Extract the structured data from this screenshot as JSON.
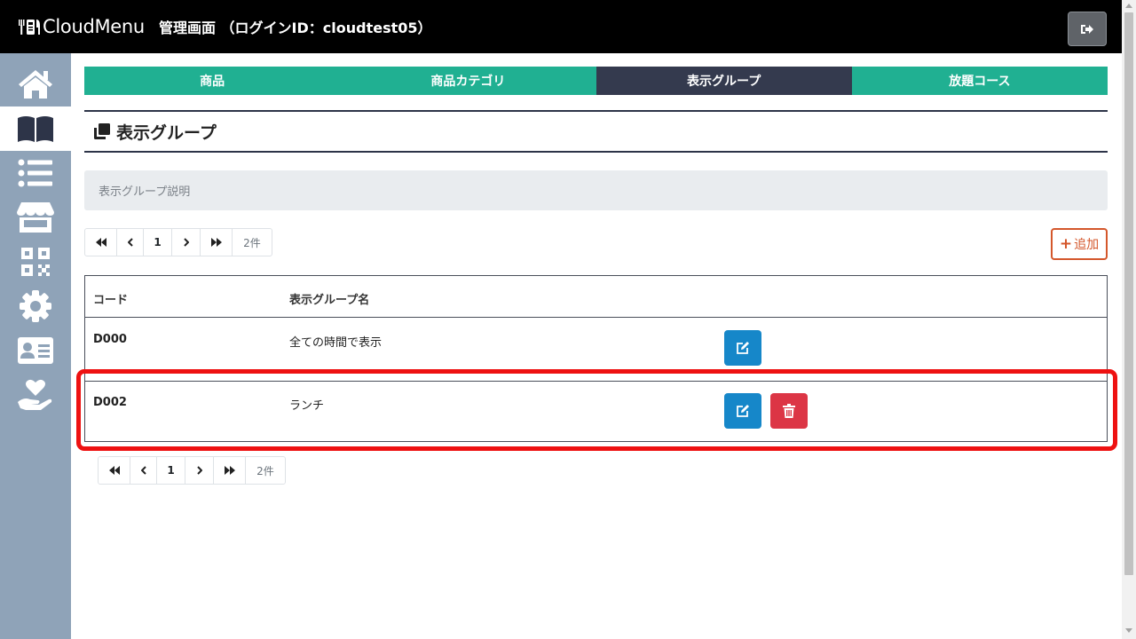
{
  "header": {
    "brand_name": "CloudMenu",
    "subtitle": "管理画面 （ログインID：cloudtest05）"
  },
  "sidebar": {
    "items": [
      {
        "icon": "home-icon"
      },
      {
        "icon": "menu-book-icon",
        "active": true
      },
      {
        "icon": "list-icon"
      },
      {
        "icon": "store-icon"
      },
      {
        "icon": "qr-code-icon"
      },
      {
        "icon": "gear-icon"
      },
      {
        "icon": "id-card-icon"
      },
      {
        "icon": "hand-heart-icon"
      }
    ]
  },
  "tabs": [
    {
      "label": "商品",
      "active": false
    },
    {
      "label": "商品カテゴリ",
      "active": false
    },
    {
      "label": "表示グループ",
      "active": true
    },
    {
      "label": "放題コース",
      "active": false
    }
  ],
  "page": {
    "title": "表示グループ",
    "description": "表示グループ説明"
  },
  "pagination": {
    "current_page": "1",
    "total": "2件"
  },
  "add_button": {
    "label": "追加"
  },
  "table": {
    "headers": {
      "code": "コード",
      "name": "表示グループ名"
    },
    "rows": [
      {
        "code": "D000",
        "name": "全ての時間で表示",
        "deletable": false
      },
      {
        "code": "D002",
        "name": "ランチ",
        "deletable": true
      }
    ]
  },
  "colors": {
    "tab_green": "#20b092",
    "tab_active": "#343a4e",
    "edit_blue": "#1687c9",
    "delete_red": "#dc3545",
    "add_orange": "#d4572b",
    "highlight_red": "#ee1111",
    "sidebar": "#8fa3b8"
  }
}
